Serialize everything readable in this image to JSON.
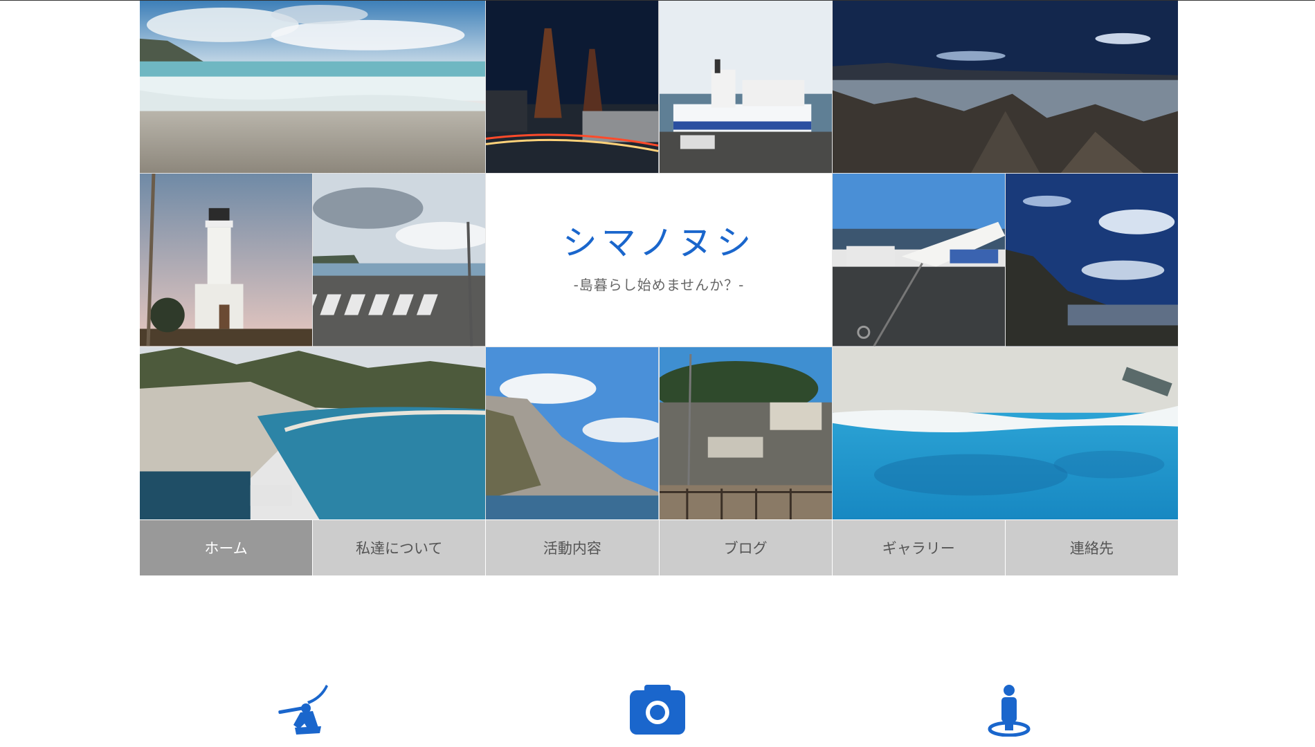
{
  "site": {
    "title": "シマノヌシ",
    "subtitle": "-島暮らし始めませんか？-"
  },
  "gallery": [
    {
      "name": "beach-waves-photo"
    },
    {
      "name": "power-plant-night-photo"
    },
    {
      "name": "ferry-ship-photo"
    },
    {
      "name": "rocky-coast-night-photo"
    },
    {
      "name": "lighthouse-photo"
    },
    {
      "name": "crosswalk-road-photo"
    },
    {
      "name": "harbor-boats-photo"
    },
    {
      "name": "night-sky-coast-photo"
    },
    {
      "name": "island-bay-aerial-photo"
    },
    {
      "name": "volcanic-cliff-photo"
    },
    {
      "name": "village-houses-photo"
    },
    {
      "name": "turquoise-sea-aerial-photo"
    }
  ],
  "nav": {
    "active_index": 0,
    "items": [
      {
        "label": "ホーム"
      },
      {
        "label": "私達について"
      },
      {
        "label": "活動内容"
      },
      {
        "label": "ブログ"
      },
      {
        "label": "ギャラリー"
      },
      {
        "label": "連絡先"
      }
    ]
  },
  "features": [
    {
      "icon": "fisherman-icon"
    },
    {
      "icon": "camera-icon"
    },
    {
      "icon": "person-location-icon"
    }
  ],
  "colors": {
    "accent": "#1a66cc",
    "nav_bg": "#cccccc",
    "nav_active_bg": "#999999"
  }
}
